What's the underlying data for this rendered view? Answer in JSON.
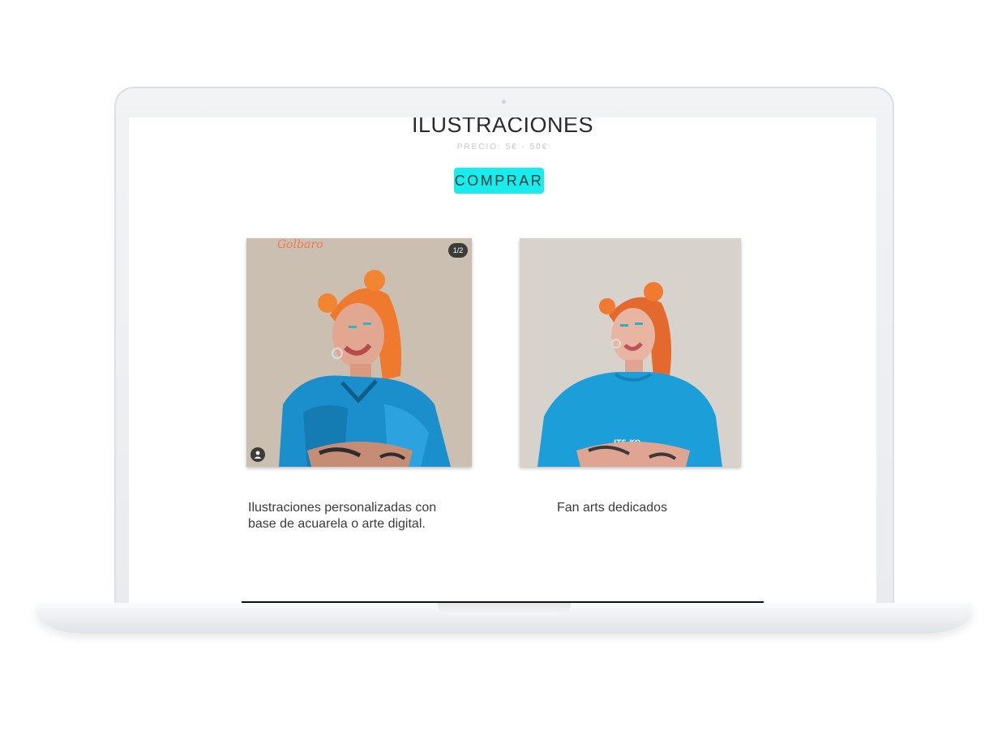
{
  "page": {
    "title": "ILUSTRACIONES",
    "price": "PRECIO:  5€ - 50€",
    "buy_label": "COMPRAR"
  },
  "gallery": [
    {
      "counter": "1/2",
      "signature": "Golbaro",
      "caption": "Ilustraciones personalizadas con base de acuarela o arte digital."
    },
    {
      "shirt_text": "ITS KO",
      "caption": "Fan arts dedicados"
    }
  ],
  "colors": {
    "accent": "#18ecec",
    "hair": "#ef7a2e",
    "sweater": "#1a8fcc"
  }
}
